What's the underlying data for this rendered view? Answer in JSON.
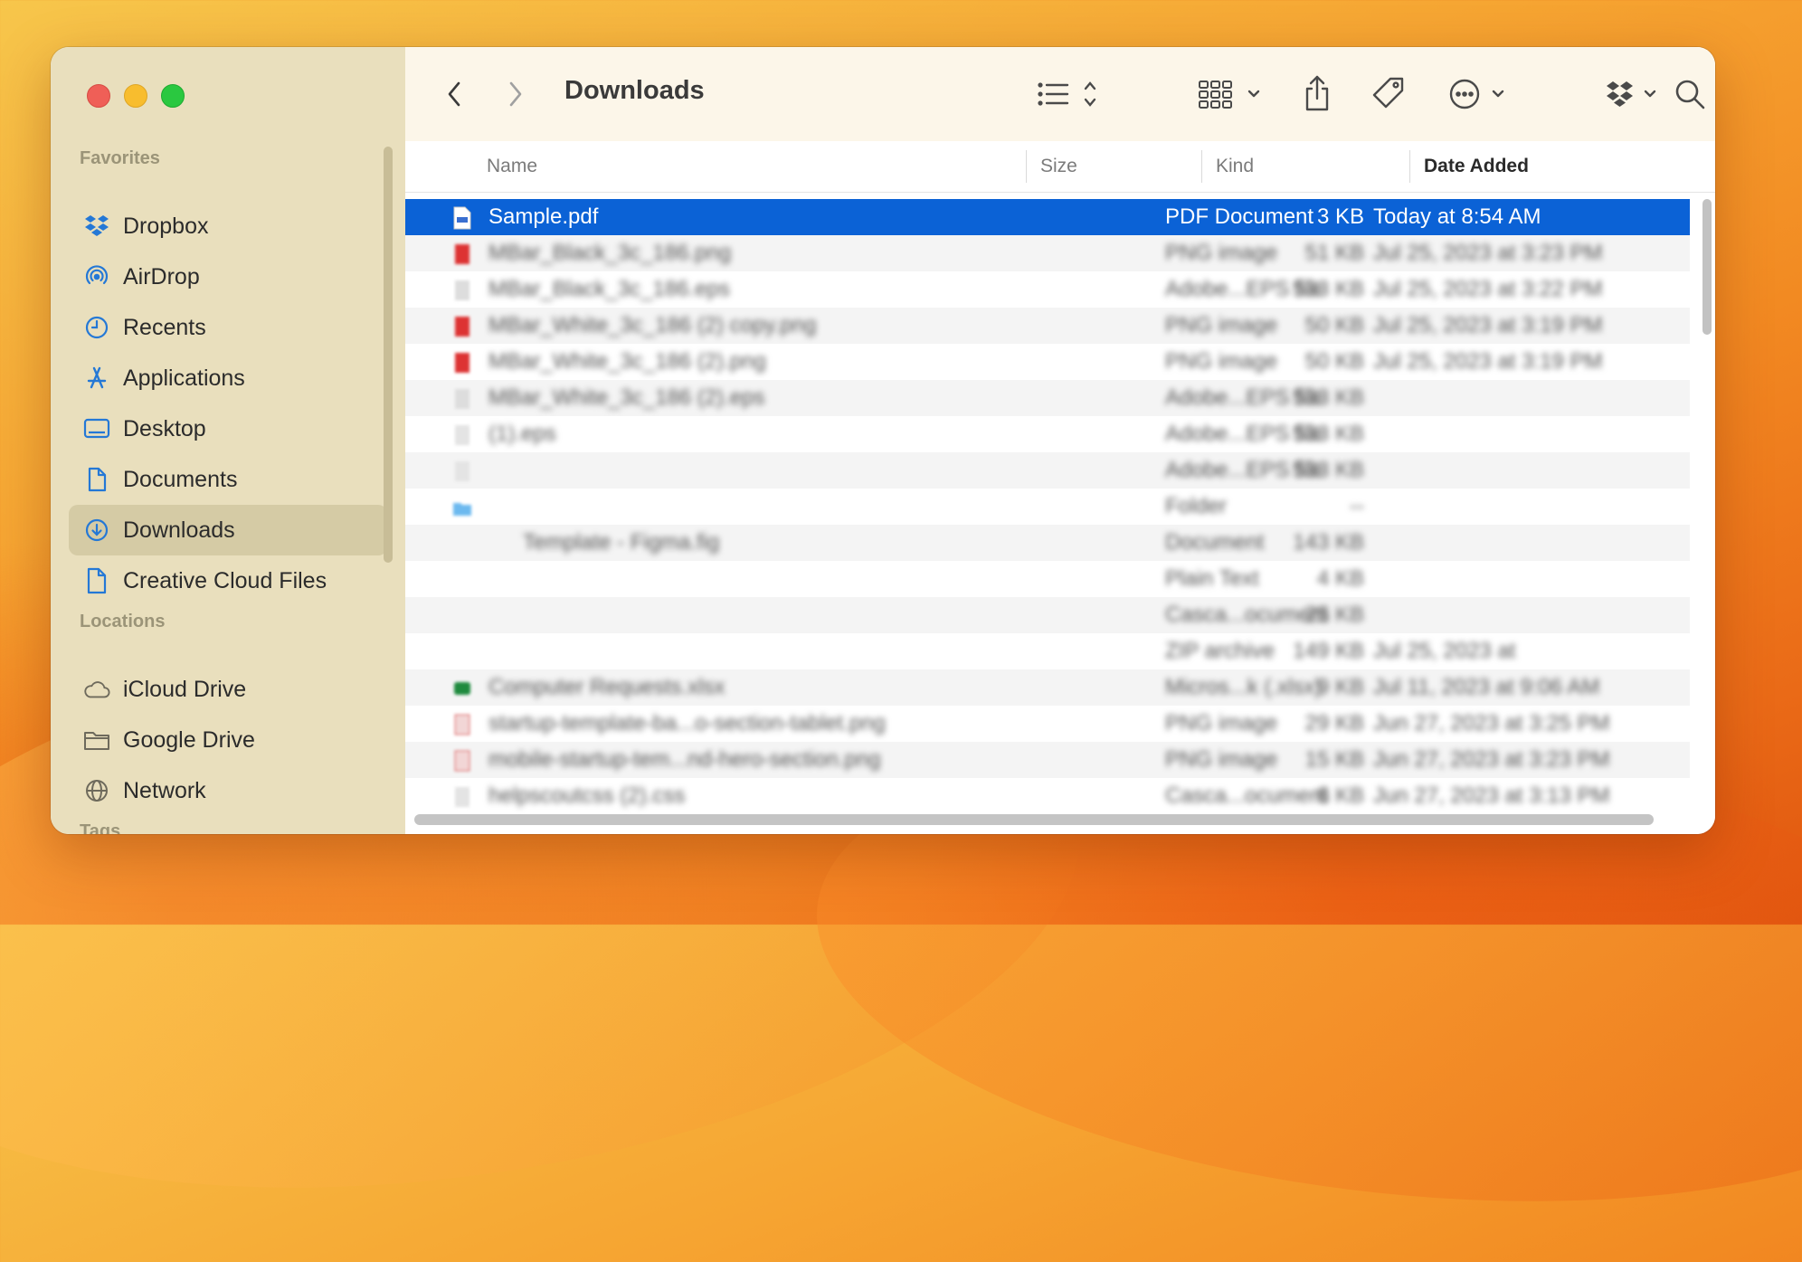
{
  "window": {
    "title": "Downloads"
  },
  "sidebar": {
    "favorites_label": "Favorites",
    "favorites": [
      {
        "label": "Dropbox",
        "icon": "dropbox-icon"
      },
      {
        "label": "AirDrop",
        "icon": "airdrop-icon"
      },
      {
        "label": "Recents",
        "icon": "clock-icon"
      },
      {
        "label": "Applications",
        "icon": "applications-icon"
      },
      {
        "label": "Desktop",
        "icon": "desktop-icon"
      },
      {
        "label": "Documents",
        "icon": "document-icon"
      },
      {
        "label": "Downloads",
        "icon": "download-icon",
        "active": true
      },
      {
        "label": "Creative Cloud Files",
        "icon": "file-icon"
      }
    ],
    "locations_label": "Locations",
    "locations": [
      {
        "label": "iCloud Drive",
        "icon": "cloud-icon"
      },
      {
        "label": "Google Drive",
        "icon": "folder-icon"
      },
      {
        "label": "Network",
        "icon": "globe-icon"
      }
    ],
    "tags_label": "Tags"
  },
  "columns": {
    "name": "Name",
    "size": "Size",
    "kind": "Kind",
    "date": "Date Added"
  },
  "files": [
    {
      "name": "Sample.pdf",
      "size": "3 KB",
      "kind": "PDF Document",
      "date": "Today at 8:54 AM"
    },
    {
      "name": "MBar_Black_3c_186.png",
      "size": "51 KB",
      "kind": "PNG image",
      "date": "Jul 25, 2023 at 3:23 PM"
    },
    {
      "name": "MBar_Black_3c_186.eps",
      "size": "533 KB",
      "kind": "Adobe...EPS file",
      "date": "Jul 25, 2023 at 3:22 PM"
    },
    {
      "name": "MBar_White_3c_186 (2) copy.png",
      "size": "50 KB",
      "kind": "PNG image",
      "date": "Jul 25, 2023 at 3:19 PM"
    },
    {
      "name": "MBar_White_3c_186 (2).png",
      "size": "50 KB",
      "kind": "PNG image",
      "date": "Jul 25, 2023 at 3:19 PM"
    },
    {
      "name": "MBar_White_3c_186 (2).eps",
      "size": "533 KB",
      "kind": "Adobe...EPS file",
      "date": ""
    },
    {
      "name": "(1).eps",
      "size": "533 KB",
      "kind": "Adobe...EPS file",
      "date": ""
    },
    {
      "name": "",
      "size": "533 KB",
      "kind": "Adobe...EPS file",
      "date": ""
    },
    {
      "name": "",
      "size": "--",
      "kind": "Folder",
      "date": ""
    },
    {
      "name": "Template - Figma.fig",
      "size": "143 KB",
      "kind": "Document",
      "date": ""
    },
    {
      "name": "",
      "size": "4 KB",
      "kind": "Plain Text",
      "date": ""
    },
    {
      "name": "",
      "size": "25 KB",
      "kind": "Casca...ocument",
      "date": ""
    },
    {
      "name": "",
      "size": "149 KB",
      "kind": "ZIP archive",
      "date": "Jul 25, 2023 at"
    },
    {
      "name": "Computer Requests.xlsx",
      "size": "9 KB",
      "kind": "Micros...k (.xlsx)",
      "date": "Jul 11, 2023 at 9:06 AM"
    },
    {
      "name": "startup-template-ba...o-section-tablet.png",
      "size": "29 KB",
      "kind": "PNG image",
      "date": "Jun 27, 2023 at 3:25 PM"
    },
    {
      "name": "mobile-startup-tem...nd-hero-section.png",
      "size": "15 KB",
      "kind": "PNG image",
      "date": "Jun 27, 2023 at 3:23 PM"
    },
    {
      "name": "helpscoutcss (2).css",
      "size": "6 KB",
      "kind": "Casca...ocument",
      "date": "Jun 27, 2023 at 3:13 PM"
    }
  ],
  "colors": {
    "selection": "#0b62d6",
    "accent": "#2478d6",
    "sidebar_bg": "#e9dfbd"
  }
}
